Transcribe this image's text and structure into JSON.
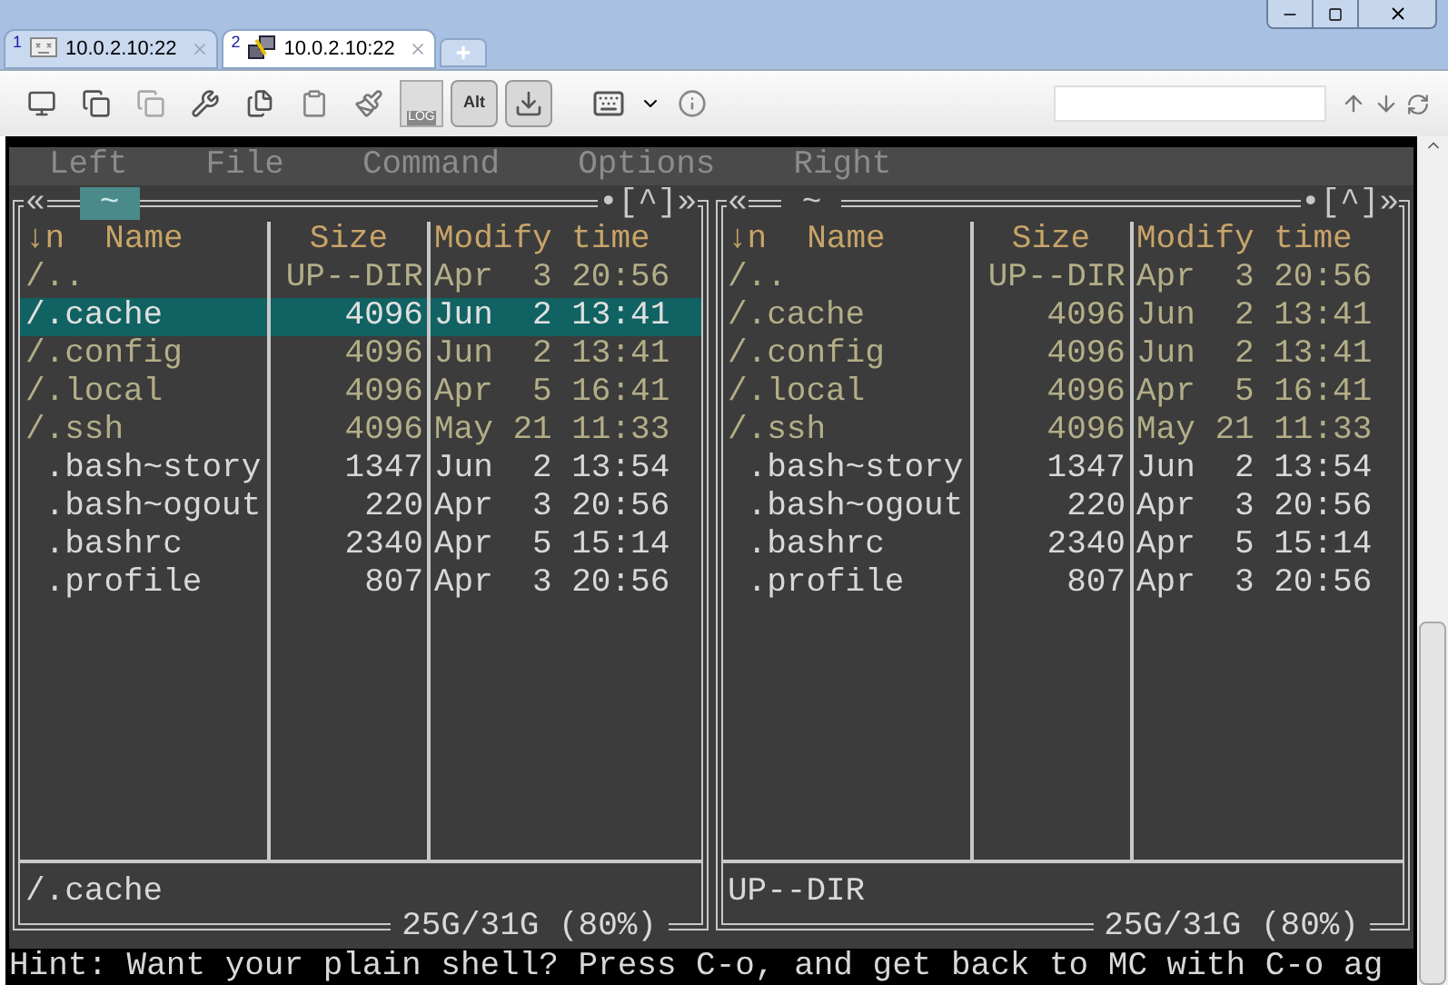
{
  "tabs": [
    {
      "number": "1",
      "label": "10.0.2.10:22",
      "kind": "disconnected",
      "selected": false
    },
    {
      "number": "2",
      "label": "10.0.2.10:22",
      "kind": "connected",
      "selected": true
    }
  ],
  "toolbar": {
    "log_label": "LOG",
    "alt_label": "Alt"
  },
  "menu": [
    "Left",
    "File",
    "Command",
    "Options",
    "Right"
  ],
  "panels": [
    {
      "active": true,
      "left_mark": "«",
      "path": "~",
      "right_mark": "•[^]»",
      "sort": "↓n",
      "columns": [
        "Name",
        "Size",
        "Modify time"
      ],
      "rows": [
        {
          "name": "/..",
          "size": "UP--DIR",
          "date": "Apr  3 20:56",
          "kind": "dir",
          "selected": false
        },
        {
          "name": "/.cache",
          "size": "4096",
          "date": "Jun  2 13:41",
          "kind": "dir",
          "selected": true
        },
        {
          "name": "/.config",
          "size": "4096",
          "date": "Jun  2 13:41",
          "kind": "dir",
          "selected": false
        },
        {
          "name": "/.local",
          "size": "4096",
          "date": "Apr  5 16:41",
          "kind": "dir",
          "selected": false
        },
        {
          "name": "/.ssh",
          "size": "4096",
          "date": "May 21 11:33",
          "kind": "dir",
          "selected": false
        },
        {
          "name": " .bash~story",
          "size": "1347",
          "date": "Jun  2 13:54",
          "kind": "file",
          "selected": false
        },
        {
          "name": " .bash~ogout",
          "size": "220",
          "date": "Apr  3 20:56",
          "kind": "file",
          "selected": false
        },
        {
          "name": " .bashrc",
          "size": "2340",
          "date": "Apr  5 15:14",
          "kind": "file",
          "selected": false
        },
        {
          "name": " .profile",
          "size": "807",
          "date": "Apr  3 20:56",
          "kind": "file",
          "selected": false
        }
      ],
      "status": "/.cache",
      "free": "25G/31G (80%)"
    },
    {
      "active": false,
      "left_mark": "«",
      "path": "~",
      "right_mark": "•[^]»",
      "sort": "↓n",
      "columns": [
        "Name",
        "Size",
        "Modify time"
      ],
      "rows": [
        {
          "name": "/..",
          "size": "UP--DIR",
          "date": "Apr  3 20:56",
          "kind": "dir",
          "selected": false
        },
        {
          "name": "/.cache",
          "size": "4096",
          "date": "Jun  2 13:41",
          "kind": "dir",
          "selected": false
        },
        {
          "name": "/.config",
          "size": "4096",
          "date": "Jun  2 13:41",
          "kind": "dir",
          "selected": false
        },
        {
          "name": "/.local",
          "size": "4096",
          "date": "Apr  5 16:41",
          "kind": "dir",
          "selected": false
        },
        {
          "name": "/.ssh",
          "size": "4096",
          "date": "May 21 11:33",
          "kind": "dir",
          "selected": false
        },
        {
          "name": " .bash~story",
          "size": "1347",
          "date": "Jun  2 13:54",
          "kind": "file",
          "selected": false
        },
        {
          "name": " .bash~ogout",
          "size": "220",
          "date": "Apr  3 20:56",
          "kind": "file",
          "selected": false
        },
        {
          "name": " .bashrc",
          "size": "2340",
          "date": "Apr  5 15:14",
          "kind": "file",
          "selected": false
        },
        {
          "name": " .profile",
          "size": "807",
          "date": "Apr  3 20:56",
          "kind": "file",
          "selected": false
        }
      ],
      "status": "UP--DIR",
      "free": "25G/31G (80%)"
    }
  ],
  "hint": "Hint: Want your plain shell? Press C-o, and get back to MC with C-o ag"
}
